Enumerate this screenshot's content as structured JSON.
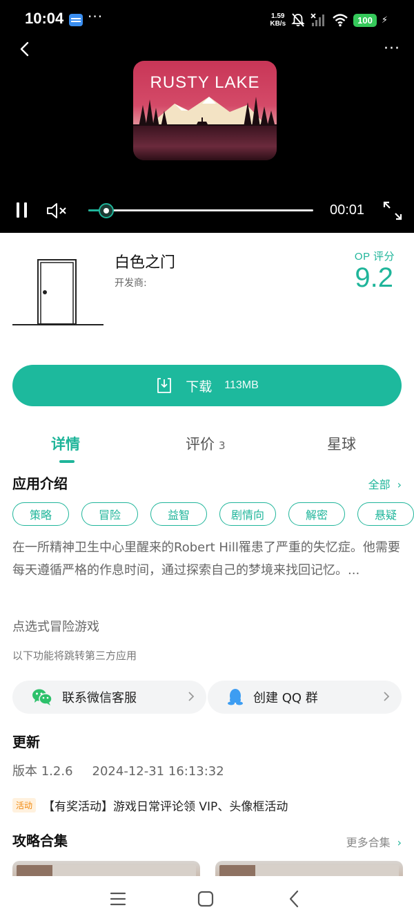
{
  "status_bar": {
    "time": "10:04",
    "more": "···",
    "speed_value": "1.59",
    "speed_unit": "KB/s",
    "battery": "100"
  },
  "video": {
    "more": "···",
    "cover_title": "RUSTY LAKE",
    "elapsed": "00:01",
    "progress_fraction": 0.08
  },
  "app": {
    "name": "白色之门",
    "developer_label": "开发商:",
    "rating_label": "OP 评分",
    "rating": "9.2"
  },
  "download": {
    "label": "下载",
    "size": "113MB"
  },
  "tabs": {
    "detail": "详情",
    "review": "评价",
    "review_count": "3",
    "planet": "星球"
  },
  "intro": {
    "title": "应用介绍",
    "see_all": "全部",
    "tags": [
      "策略",
      "冒险",
      "益智",
      "剧情向",
      "解密",
      "悬疑"
    ],
    "description": "在一所精神卫生中心里醒来的Robert Hill罹患了严重的失忆症。他需要每天遵循严格的作息时间，通过探索自己的梦境来找回记忆。...",
    "genre": "点选式冒险游戏",
    "third_party_note": "以下功能将跳转第三方应用"
  },
  "contacts": {
    "wechat": "联系微信客服",
    "qq": "创建 QQ 群"
  },
  "update": {
    "title": "更新",
    "version": "版本 1.2.6",
    "date": "2024-12-31 16:13:32"
  },
  "activity": {
    "badge": "活动",
    "text": "【有奖活动】游戏日常评论领 VIP、头像框活动"
  },
  "guides": {
    "title": "攻略合集",
    "more": "更多合集"
  },
  "colors": {
    "accent": "#1fb59a",
    "download_bg": "#1db99d",
    "activity_badge": "#f0890f"
  },
  "icons": [
    "back-arrow-icon",
    "more-dots-icon",
    "pause-icon",
    "mute-icon",
    "fullscreen-icon",
    "download-icon",
    "chevron-right-icon",
    "wechat-icon",
    "qq-icon",
    "menu-icon",
    "home-icon"
  ]
}
